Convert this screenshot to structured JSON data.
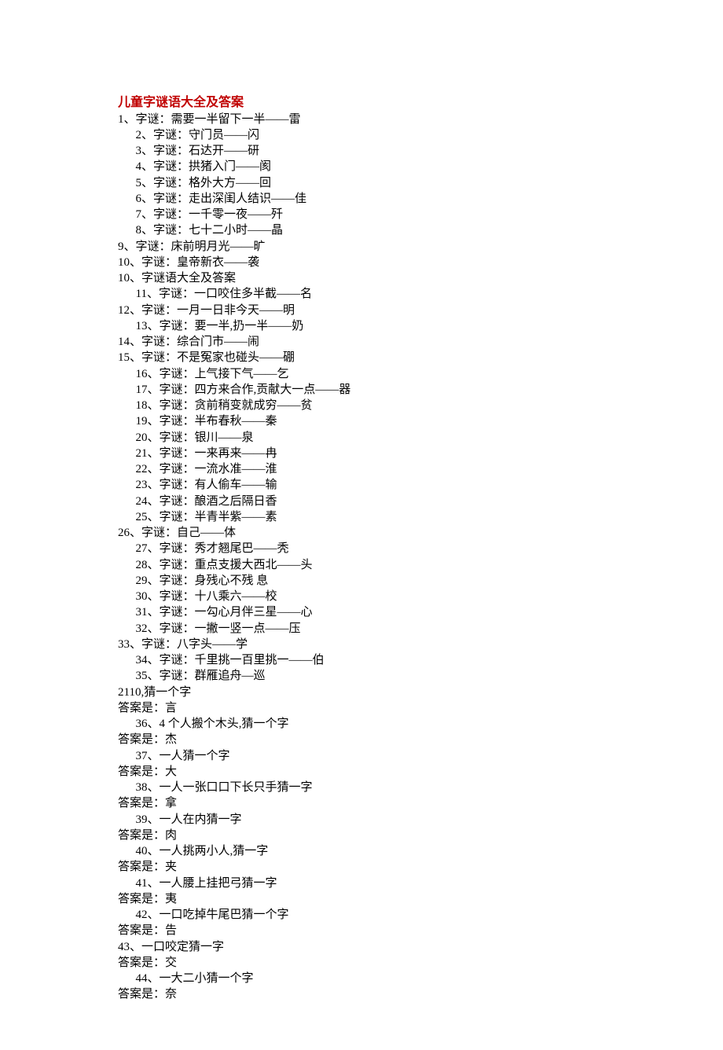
{
  "title": "儿童字谜语大全及答案",
  "lines": [
    {
      "text": "1、字谜：需要一半留下一半——雷",
      "indent": 0
    },
    {
      "text": "2、字谜：守门员——闪",
      "indent": 1
    },
    {
      "text": "3、字谜：石达开——研",
      "indent": 1
    },
    {
      "text": "4、字谜：拱猪入门——阂",
      "indent": 1
    },
    {
      "text": "5、字谜：格外大方——回",
      "indent": 1
    },
    {
      "text": "6、字谜：走出深闺人结识——佳",
      "indent": 1
    },
    {
      "text": "7、字谜：一千零一夜——歼",
      "indent": 1
    },
    {
      "text": "8、字谜：七十二小时——晶",
      "indent": 1
    },
    {
      "text": "9、字谜：床前明月光——旷",
      "indent": 0
    },
    {
      "text": "10、字谜：皇帝新衣——袭",
      "indent": 0
    },
    {
      "text": "10、字谜语大全及答案",
      "indent": 0
    },
    {
      "text": "11、字谜：一口咬住多半截——名",
      "indent": 1
    },
    {
      "text": "12、字谜：一月一日非今天——明",
      "indent": 0
    },
    {
      "text": "13、字谜：要一半,扔一半——奶",
      "indent": 1
    },
    {
      "text": "14、字谜：综合门市——闹",
      "indent": 0
    },
    {
      "text": "15、字谜：不是冤家也碰头——硼",
      "indent": 0
    },
    {
      "text": "16、字谜：上气接下气——乞",
      "indent": 1
    },
    {
      "text": "17、字谜：四方来合作,贡献大一点——器",
      "indent": 1
    },
    {
      "text": "18、字谜：贪前稍变就成穷——贫",
      "indent": 1
    },
    {
      "text": "19、字谜：半布春秋——秦",
      "indent": 1
    },
    {
      "text": "20、字谜：银川——泉",
      "indent": 1
    },
    {
      "text": "21、字谜：一来再来——冉",
      "indent": 1
    },
    {
      "text": "22、字谜：一流水准——淮",
      "indent": 1
    },
    {
      "text": "23、字谜：有人偷车——输",
      "indent": 1
    },
    {
      "text": "24、字谜：酿酒之后隔日香",
      "indent": 1
    },
    {
      "text": "25、字谜：半青半紫——素",
      "indent": 1
    },
    {
      "text": "26、字谜：自己——体",
      "indent": 0
    },
    {
      "text": "27、字谜：秀才翘尾巴——秃",
      "indent": 1
    },
    {
      "text": "28、字谜：重点支援大西北——头",
      "indent": 1
    },
    {
      "text": "29、字谜：身残心不残 息",
      "indent": 1
    },
    {
      "text": "30、字谜：十八乘六——校",
      "indent": 1
    },
    {
      "text": "31、字谜：一勾心月伴三星——心",
      "indent": 1
    },
    {
      "text": "32、字谜：一撇一竖一点——压",
      "indent": 1
    },
    {
      "text": "33、字谜：八字头——学",
      "indent": 0
    },
    {
      "text": "34、字谜：千里挑一百里挑一——伯",
      "indent": 1
    },
    {
      "text": "35、字谜：群雁追舟—巡",
      "indent": 1
    },
    {
      "text": "2110,猜一个字",
      "indent": 0
    },
    {
      "text": "答案是：言",
      "indent": 0
    },
    {
      "text": "36、4 个人搬个木头,猜一个字",
      "indent": 1
    },
    {
      "text": "答案是：杰",
      "indent": 0
    },
    {
      "text": "37、一人猜一个字",
      "indent": 1
    },
    {
      "text": "答案是：大",
      "indent": 0
    },
    {
      "text": "38、一人一张口口下长只手猜一字",
      "indent": 1
    },
    {
      "text": "答案是：拿",
      "indent": 0
    },
    {
      "text": "39、一人在内猜一字",
      "indent": 1
    },
    {
      "text": "答案是：肉",
      "indent": 0
    },
    {
      "text": "40、一人挑两小人,猜一字",
      "indent": 1
    },
    {
      "text": "答案是：夹",
      "indent": 0
    },
    {
      "text": "41、一人腰上挂把弓猜一字",
      "indent": 1
    },
    {
      "text": "答案是：夷",
      "indent": 0
    },
    {
      "text": "42、一口吃掉牛尾巴猜一个字",
      "indent": 1
    },
    {
      "text": "答案是：告",
      "indent": 0
    },
    {
      "text": "43、一口咬定猜一字",
      "indent": 0
    },
    {
      "text": "答案是：交",
      "indent": 0
    },
    {
      "text": "44、一大二小猜一个字",
      "indent": 1
    },
    {
      "text": "答案是：奈",
      "indent": 0
    }
  ]
}
